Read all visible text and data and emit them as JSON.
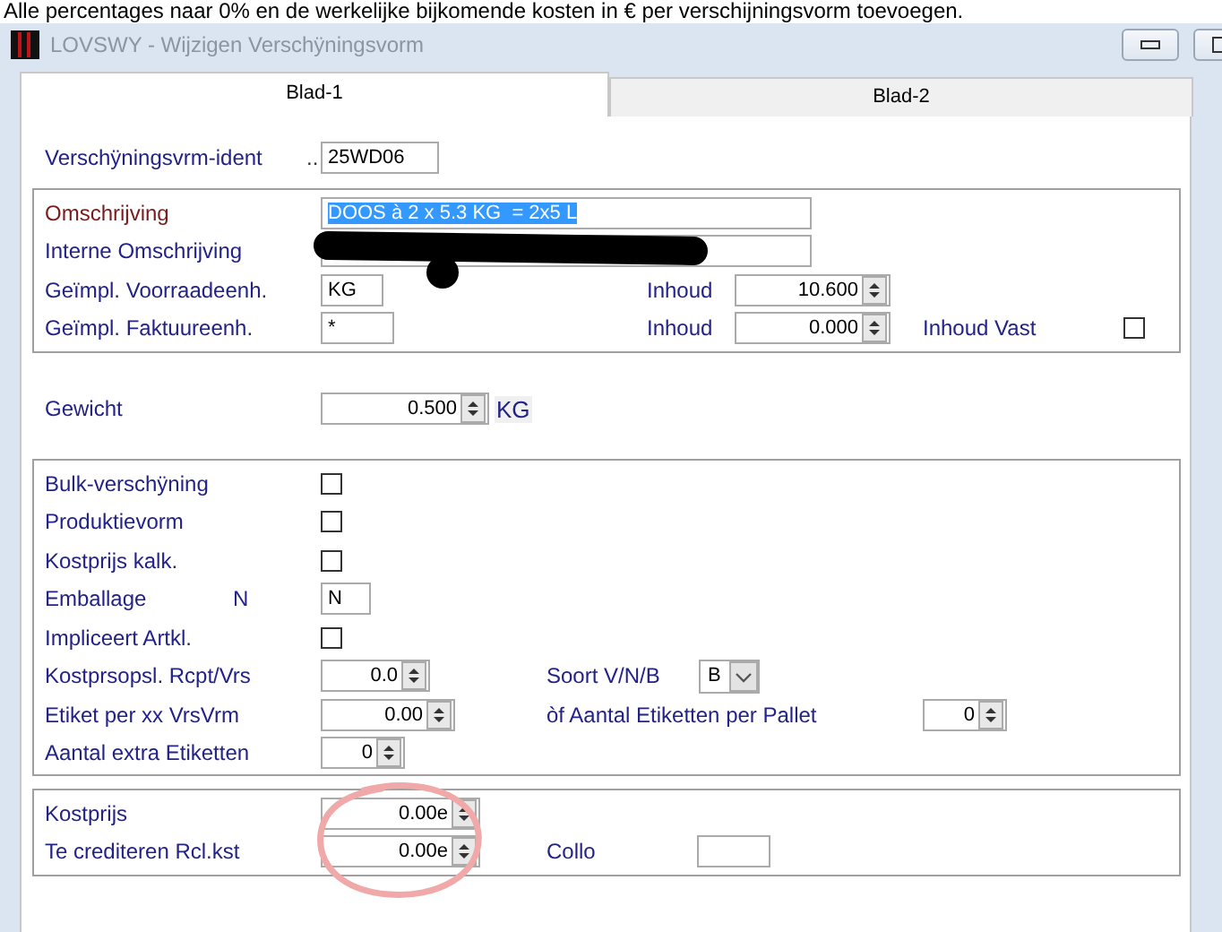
{
  "top_note": "Alle percentages naar 0% en de werkelijke bijkomende kosten in € per verschijningsvorm toevoegen.",
  "window": {
    "title": "LOVSWY - Wijzigen Verschÿningsvorm"
  },
  "tabs": [
    {
      "label": "Blad-1",
      "selected": true
    },
    {
      "label": "Blad-2",
      "selected": false
    }
  ],
  "ident": {
    "label": "Verschÿningsvrm-ident",
    "dots": "..",
    "value": "25WD06"
  },
  "description": {
    "omschrijving": {
      "label": "Omschrijving",
      "value": "DOOS à 2 x 5.3 KG  = 2x5 L",
      "highlighted": true
    },
    "interne": {
      "label": "Interne Omschrijving",
      "redacted": true
    },
    "voorraad": {
      "label": "Geïmpl. Voorraadeenh.",
      "value": "KG",
      "inhoud_label": "Inhoud",
      "inhoud_value": "10.600"
    },
    "faktuur": {
      "label": "Geïmpl. Faktuureenh.",
      "value": "*",
      "inhoud_label": "Inhoud",
      "inhoud_value": "0.000",
      "vast_label": "Inhoud Vast",
      "vast_checked": false
    }
  },
  "gewicht": {
    "label": "Gewicht",
    "value": "0.500",
    "unit": "KG"
  },
  "options": {
    "bulk": {
      "label": "Bulk-verschÿning",
      "checked": false
    },
    "produktievorm": {
      "label": "Produktievorm",
      "checked": false
    },
    "kostprijs_kalk": {
      "label": "Kostprijs kalk.",
      "checked": false
    },
    "emballage": {
      "label": "Emballage",
      "code": "N",
      "value": "N"
    },
    "impliceert": {
      "label": "Impliceert Artkl.",
      "checked": false
    },
    "kostprsopsl": {
      "label": "Kostprsopsl. Rcpt/Vrs",
      "value": "0.0"
    },
    "soort": {
      "label": "Soort V/N/B",
      "value": "B"
    },
    "etiket": {
      "label": "Etiket per xx VrsVrm",
      "value": "0.00"
    },
    "pallet": {
      "label": "òf Aantal Etiketten per Pallet",
      "value": "0"
    },
    "extra": {
      "label": "Aantal extra Etiketten",
      "value": "0"
    }
  },
  "costs": {
    "kostprijs": {
      "label": "Kostprijs",
      "value": "0.00e"
    },
    "crediteren": {
      "label": "Te crediteren Rcl.kst",
      "value": "0.00e"
    },
    "collo": {
      "label": "Collo"
    }
  }
}
